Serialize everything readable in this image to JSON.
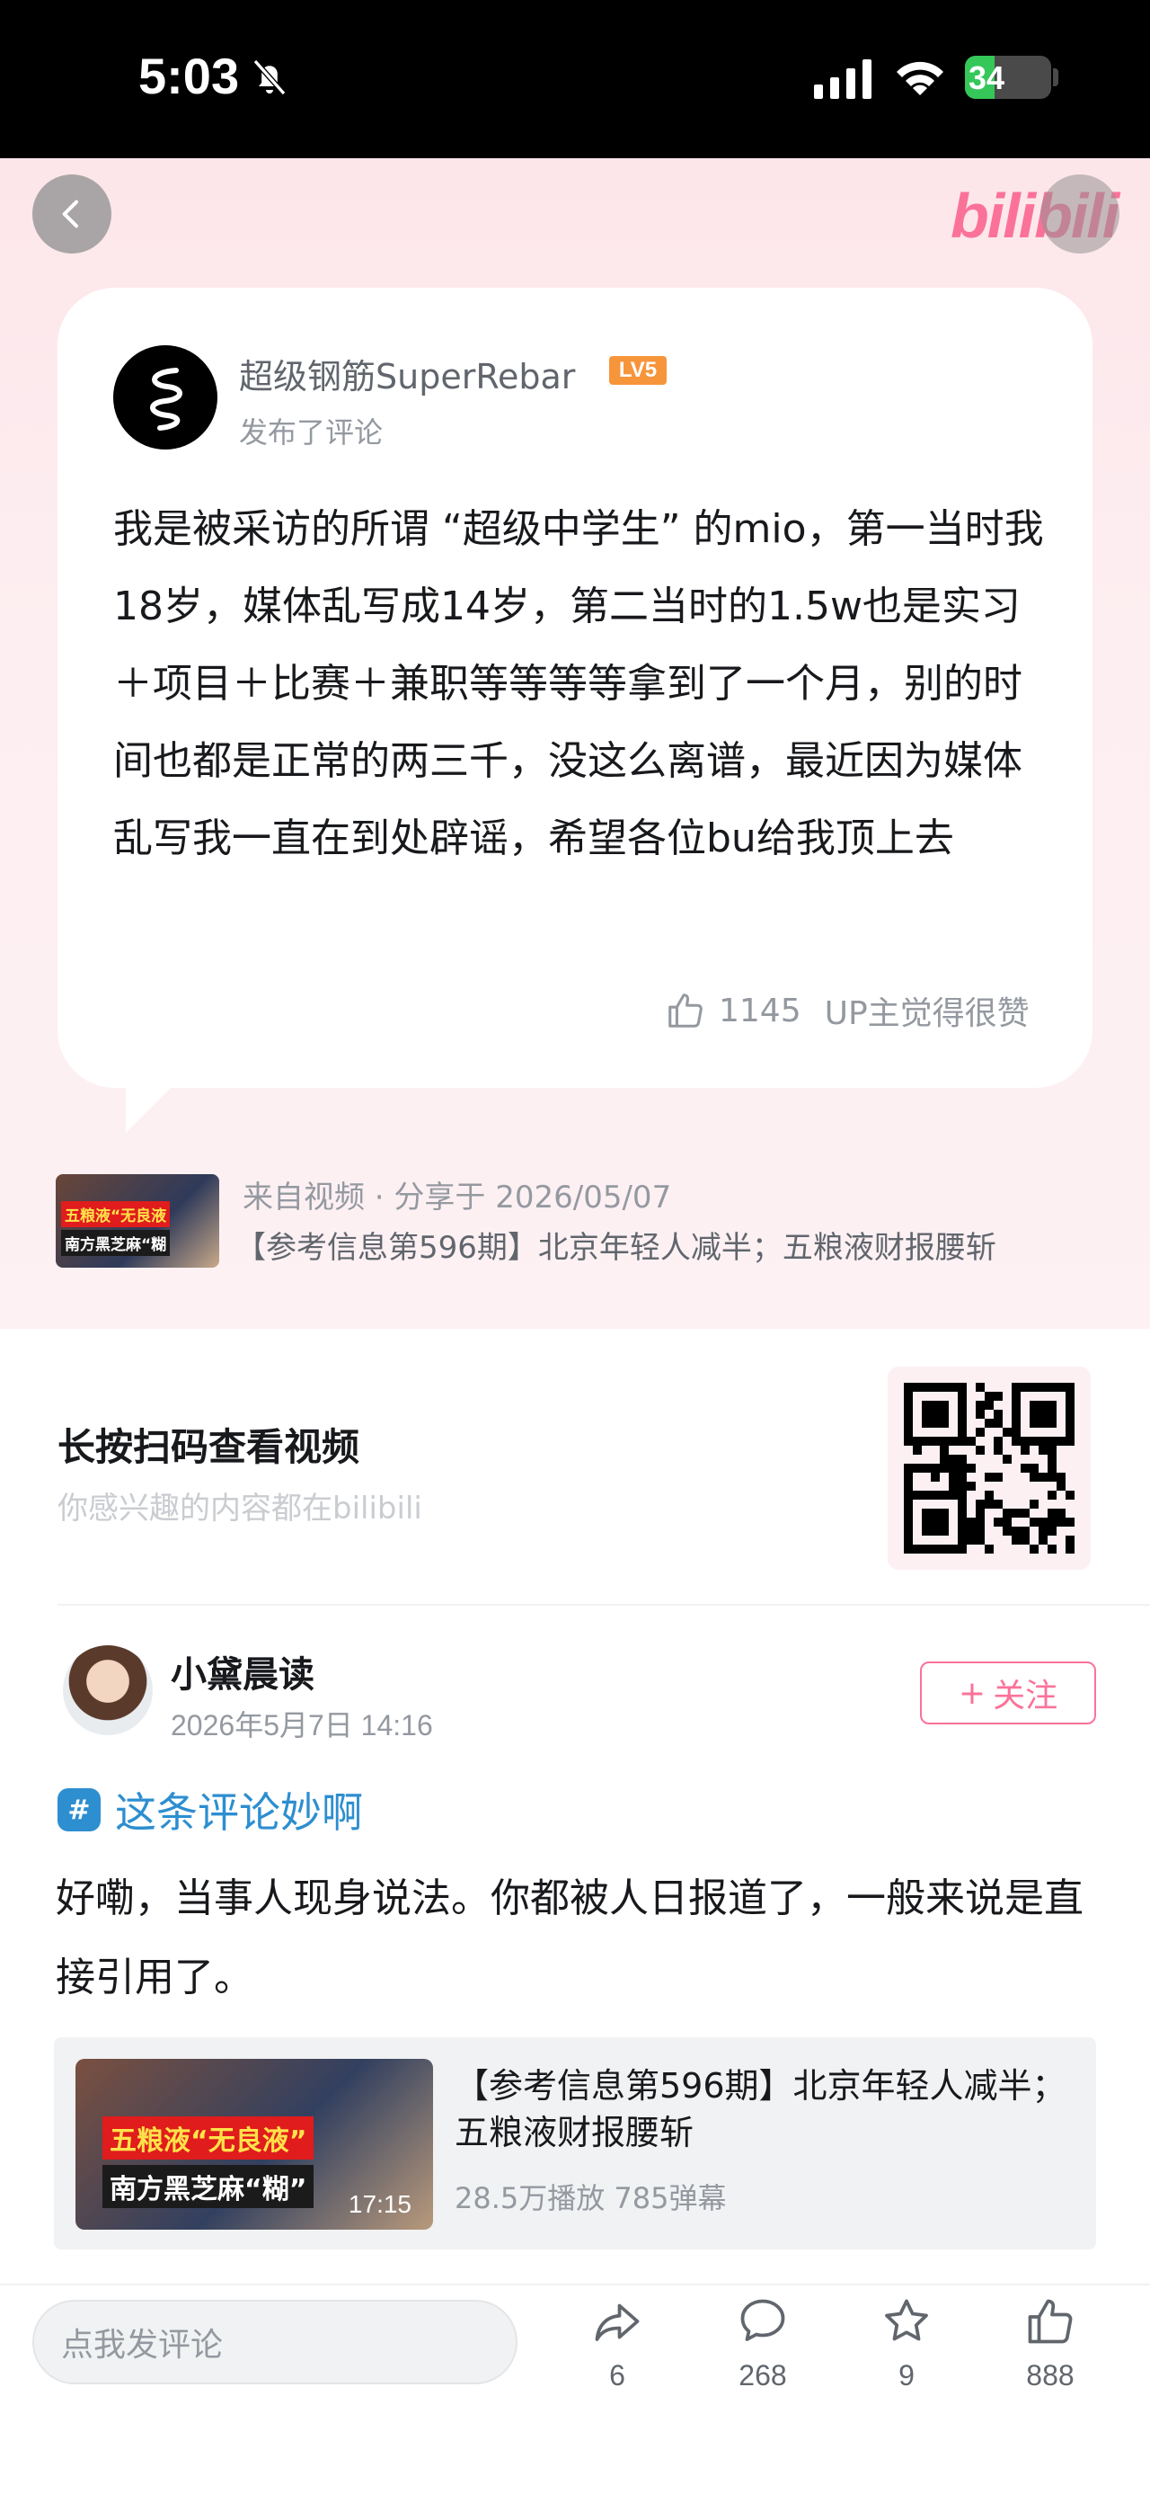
{
  "status_bar": {
    "time": "5:03",
    "battery": "34",
    "battery_level": 0.34
  },
  "header": {
    "logo": "bilibili"
  },
  "card": {
    "author": "超级钢筋SuperRebar",
    "level_badge": "LV5",
    "subtitle": "发布了评论",
    "body": "我是被采访的所谓 “超级中学生” 的mio，第一当时我18岁，媒体乱写成14岁，第二当时的1.5w也是实习＋项目＋比赛＋兼职等等等等拿到了一个月，别的时间也都是正常的两三千，没这么离谱，最近因为媒体乱写我一直在到处辟谣，希望各位bu给我顶上去",
    "likes": "1145",
    "up_like_note": "UP主觉得很赞"
  },
  "source": {
    "meta": "来自视频 · 分享于 2026/05/07",
    "title": "【参考信息第596期】北京年轻人减半；五粮液财报腰斩",
    "thumb_tag1": "五粮液“无良液",
    "thumb_tag2": "南方黑芝麻“糊"
  },
  "qr": {
    "title": "长按扫码查看视频",
    "subtitle": "你感兴趣的内容都在bilibili"
  },
  "post": {
    "author": "小黛晨读",
    "time": "2026年5月7日 14:16",
    "follow_label": "关注",
    "topic": "这条评论妙啊",
    "text": "好嘞，当事人现身说法。你都被人日报道了，一般来说是直接引用了。"
  },
  "video": {
    "title": "【参考信息第596期】北京年轻人减半；五粮液财报腰斩",
    "stats": "28.5万播放 785弹幕",
    "duration": "17:15",
    "thumb_tag1": "五粮液“无良液”",
    "thumb_tag2": "南方黑芝麻“糊”"
  },
  "bottom_bar": {
    "placeholder": "点我发评论",
    "share_count": "6",
    "comment_count": "268",
    "favorite_count": "9",
    "like_count": "888"
  },
  "colors": {
    "accent": "#fb7299",
    "topic": "#2d8ed0",
    "level": "#f7953b"
  }
}
